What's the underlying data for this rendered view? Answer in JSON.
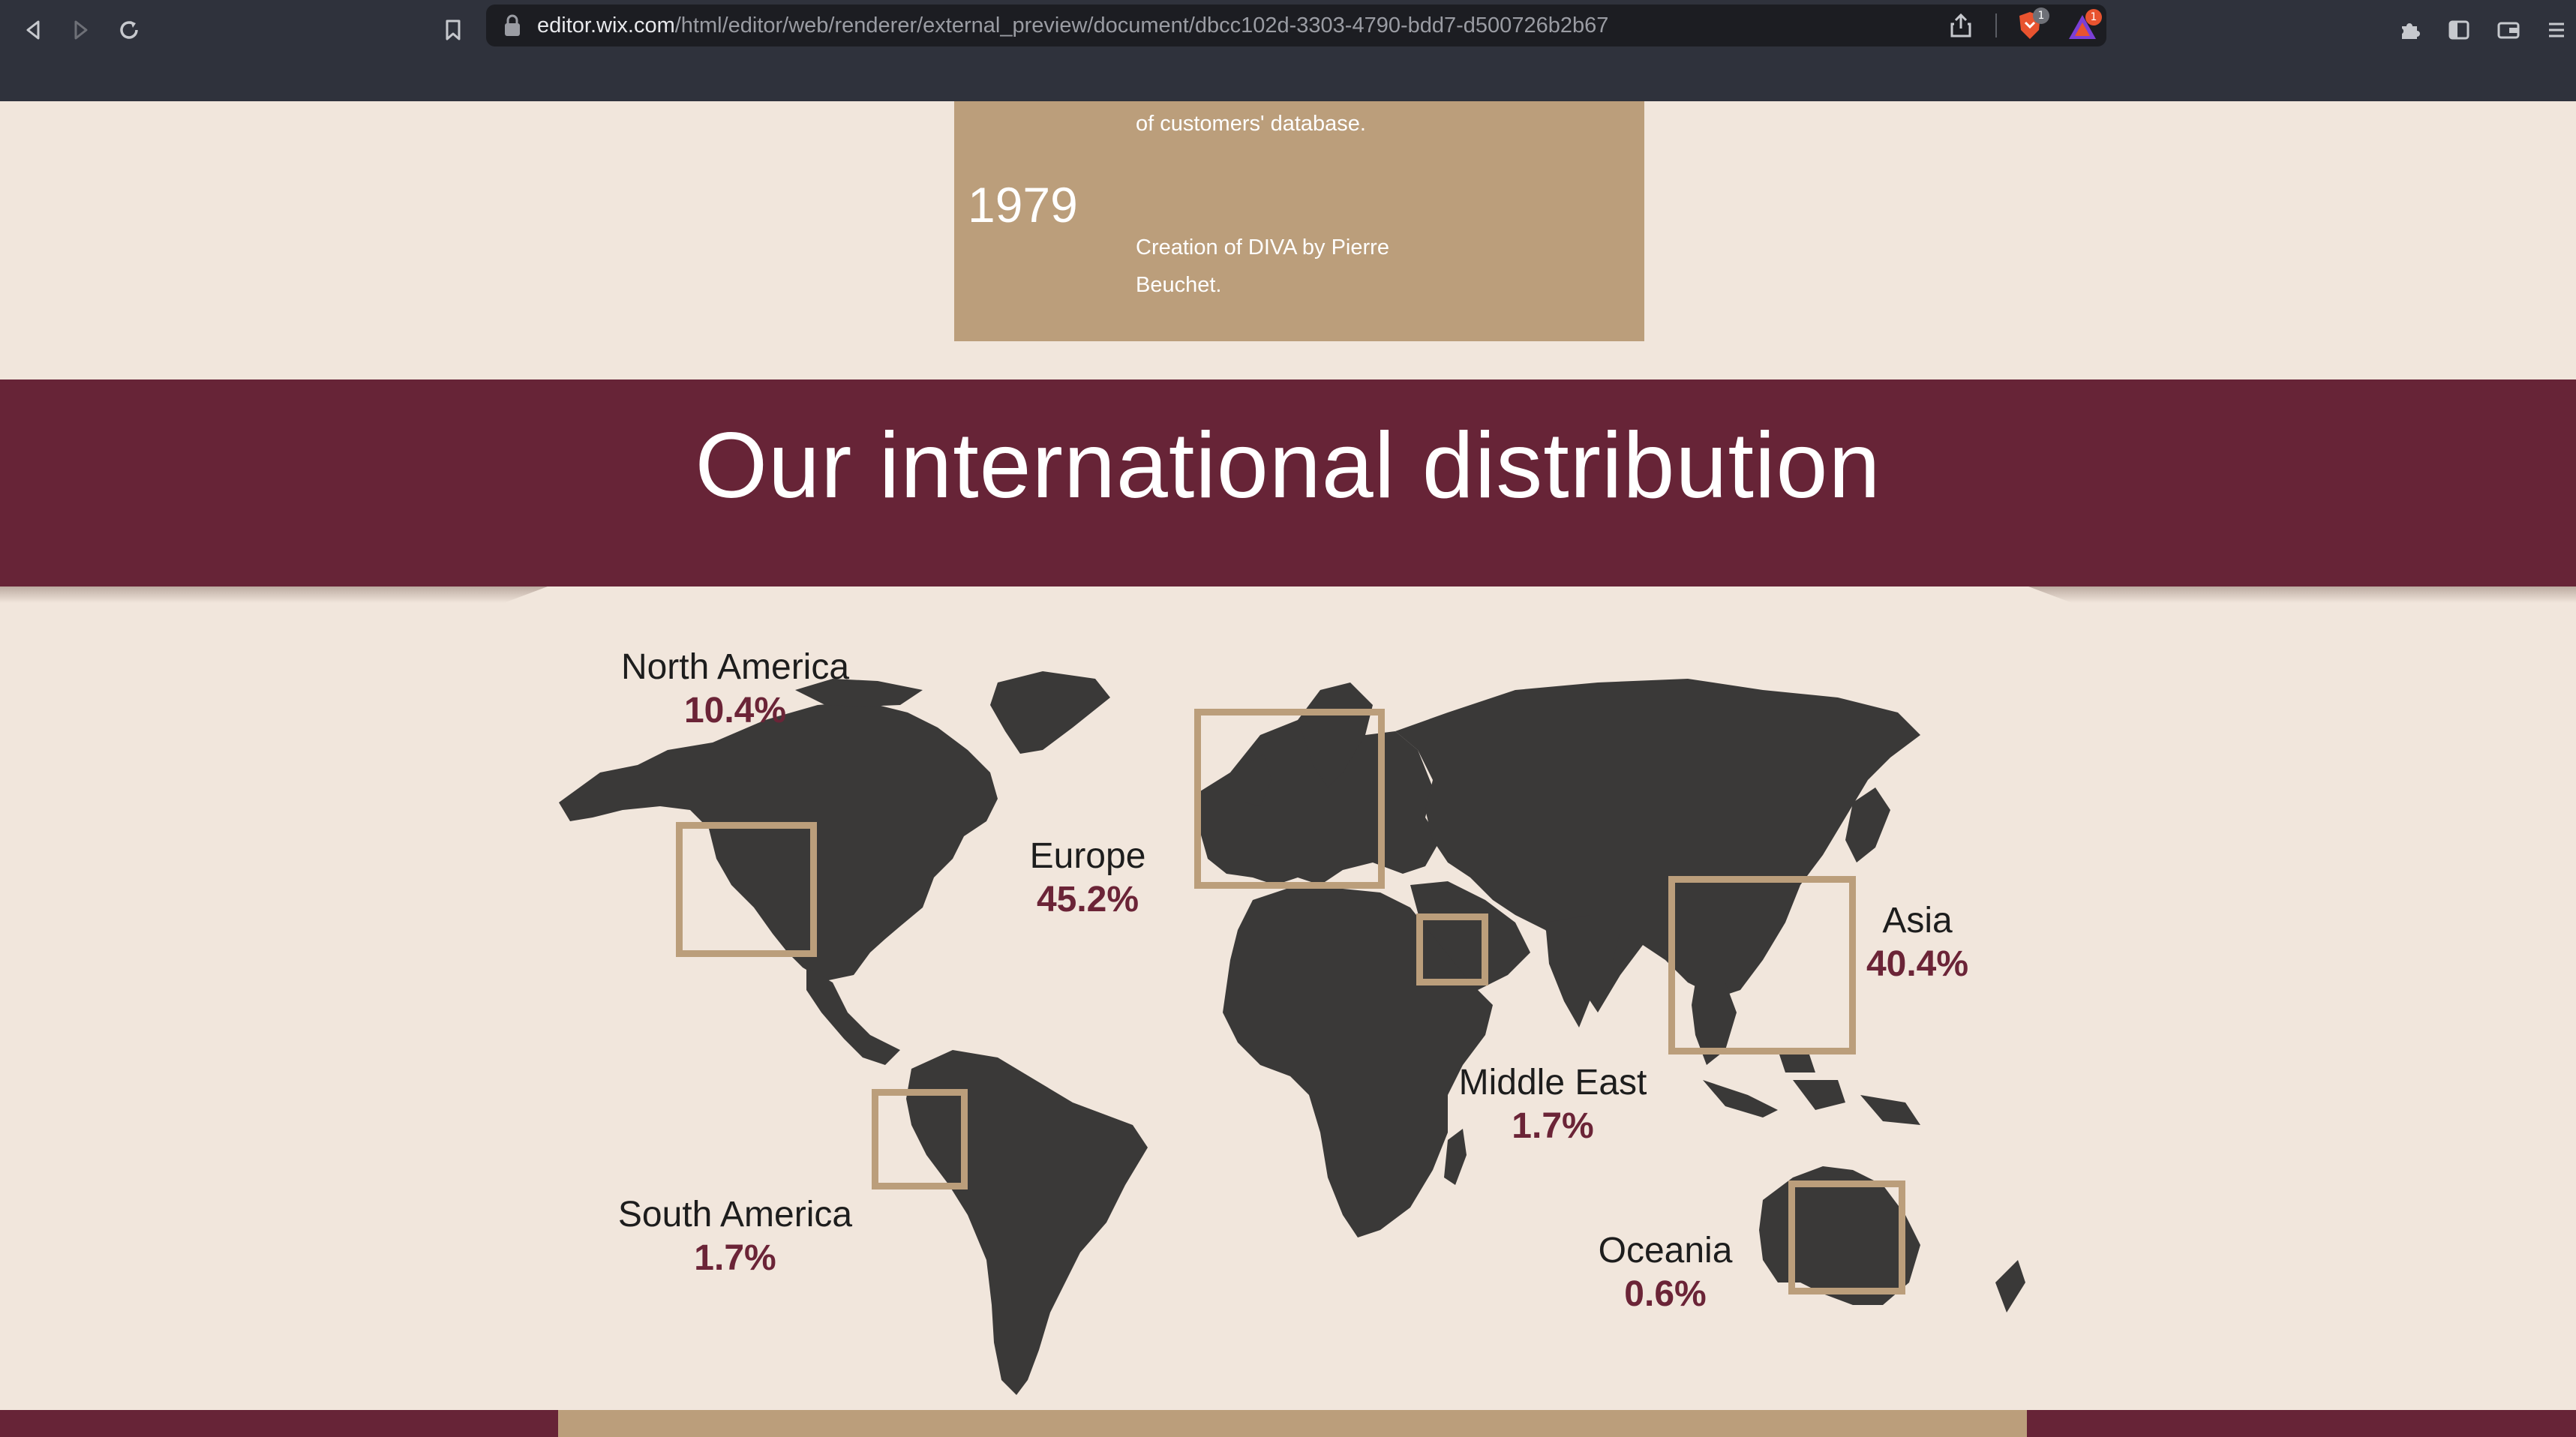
{
  "browser": {
    "url_host": "editor.wix.com",
    "url_path": "/html/editor/web/renderer/external_preview/document/dbcc102d-3303-4790-bdd7-d500726b2b67",
    "brave_badge": "1",
    "rewards_badge": "1",
    "icons": [
      "back-icon",
      "forward-icon",
      "reload-icon",
      "bookmark-icon",
      "lock-icon",
      "share-icon",
      "brave-shield-icon",
      "brave-rewards-icon",
      "extensions-icon",
      "sidebar-icon",
      "wallet-icon",
      "menu-icon"
    ]
  },
  "timeline": {
    "entry_prev_text": "of customers' database.",
    "year": "1979",
    "entry_text": "Creation of DIVA by Pierre Beuchet."
  },
  "section": {
    "title": "Our international distribution"
  },
  "regions": [
    {
      "name": "North America",
      "percent": "10.4%"
    },
    {
      "name": "Europe",
      "percent": "45.2%"
    },
    {
      "name": "Asia",
      "percent": "40.4%"
    },
    {
      "name": "Middle East",
      "percent": "1.7%"
    },
    {
      "name": "South America",
      "percent": "1.7%"
    },
    {
      "name": "Oceania",
      "percent": "0.6%"
    }
  ],
  "colors": {
    "background": "#f1e6dc",
    "accent_wine": "#672437",
    "accent_tan": "#bb9e7b",
    "map_land": "#3a3938",
    "percent_text": "#6b2437"
  }
}
